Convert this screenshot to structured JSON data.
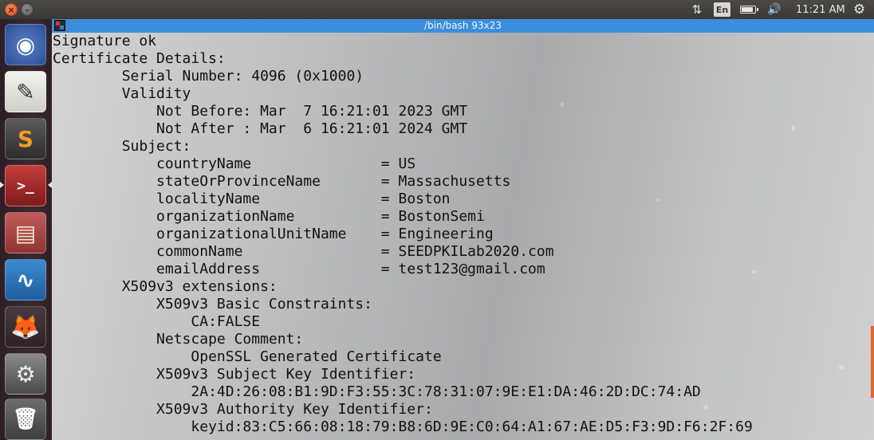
{
  "topbar": {
    "language": "En",
    "clock": "11:21 AM"
  },
  "launcher": {
    "items": [
      {
        "name": "ubuntu-dash",
        "glyph": "◉"
      },
      {
        "name": "text-editor",
        "glyph": "✎"
      },
      {
        "name": "sublime-text",
        "glyph": "S"
      },
      {
        "name": "terminal",
        "glyph": ">_"
      },
      {
        "name": "file-manager",
        "glyph": "▤"
      },
      {
        "name": "wireshark",
        "glyph": "∿"
      },
      {
        "name": "firefox",
        "glyph": "🦊"
      },
      {
        "name": "system-settings",
        "glyph": "⚙"
      },
      {
        "name": "trash",
        "glyph": "🗑"
      }
    ]
  },
  "terminal": {
    "title": "/bin/bash 93x23",
    "lines": [
      "Signature ok",
      "Certificate Details:",
      "        Serial Number: 4096 (0x1000)",
      "        Validity",
      "            Not Before: Mar  7 16:21:01 2023 GMT",
      "            Not After : Mar  6 16:21:01 2024 GMT",
      "        Subject:",
      "            countryName               = US",
      "            stateOrProvinceName       = Massachusetts",
      "            localityName              = Boston",
      "            organizationName          = BostonSemi",
      "            organizationalUnitName    = Engineering",
      "            commonName                = SEEDPKILab2020.com",
      "            emailAddress              = test123@gmail.com",
      "        X509v3 extensions:",
      "            X509v3 Basic Constraints:",
      "                CA:FALSE",
      "            Netscape Comment:",
      "                OpenSSL Generated Certificate",
      "            X509v3 Subject Key Identifier:",
      "                2A:4D:26:08:B1:9D:F3:55:3C:78:31:07:9E:E1:DA:46:2D:DC:74:AD",
      "            X509v3 Authority Key Identifier:",
      "                keyid:83:C5:66:08:18:79:B8:6D:9E:C0:64:A1:67:AE:D5:F3:9D:F6:2F:69"
    ]
  },
  "colors": {
    "titlebar": "#3c8edb",
    "launcher": "#3a2a31",
    "panel": "#3c3b37"
  }
}
